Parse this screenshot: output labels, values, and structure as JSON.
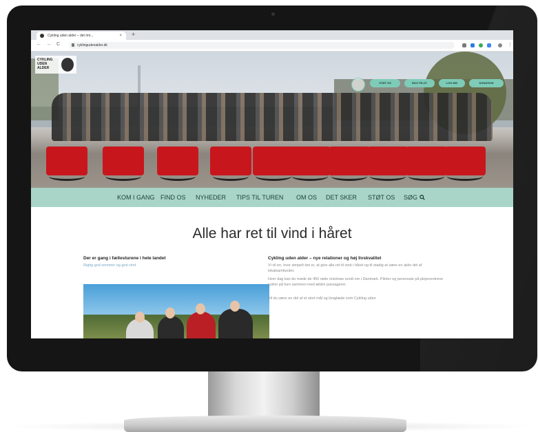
{
  "browser": {
    "tab_title": "Cykling uden alder – det rim...",
    "tab_close": "×",
    "new_tab": "+",
    "nav_back": "←",
    "nav_forward": "→",
    "nav_reload": "C",
    "url": "cyklingudenalder.dk"
  },
  "site": {
    "logo_text": "CYKLING UDEN ALDER",
    "hero_buttons": [
      "STØT OS",
      "SKIV PILOT",
      "LOG IND",
      "DONATION"
    ],
    "menu": [
      "KOM I GANG",
      "FIND OS",
      "NYHEDER",
      "TIPS TIL TUREN",
      "OM OS",
      "DET SKER",
      "STØT OS",
      "SØG"
    ],
    "search_icon": "magnifier-icon",
    "headline": "Alle har ret til vind i håret",
    "left": {
      "title": "Der er gang i fællesturene i hele landet",
      "subtitle": "Rigtig god sommer og god vind"
    },
    "right": {
      "title": "Cykling uden alder – nye relationer og høj livskvalitet",
      "p1": "Vi vil en, hvor simpelt det er, at give alle ret til vind i håret og til stadig at være en aktiv del af lokalsamfundet.",
      "p2": "Hver dag kan du møde de 450 røde rickshaw rundt om i Danmark. Piloter og personale på plejecentrene cykler på ture sammen med ældre passagerer.",
      "p3": "Vil du være en del af et stort mål og livsglæde som Cykling uden"
    }
  },
  "colors": {
    "accent": "#a8d5c7",
    "button": "#7ecbb8",
    "rickshaw": "#c8161d"
  }
}
